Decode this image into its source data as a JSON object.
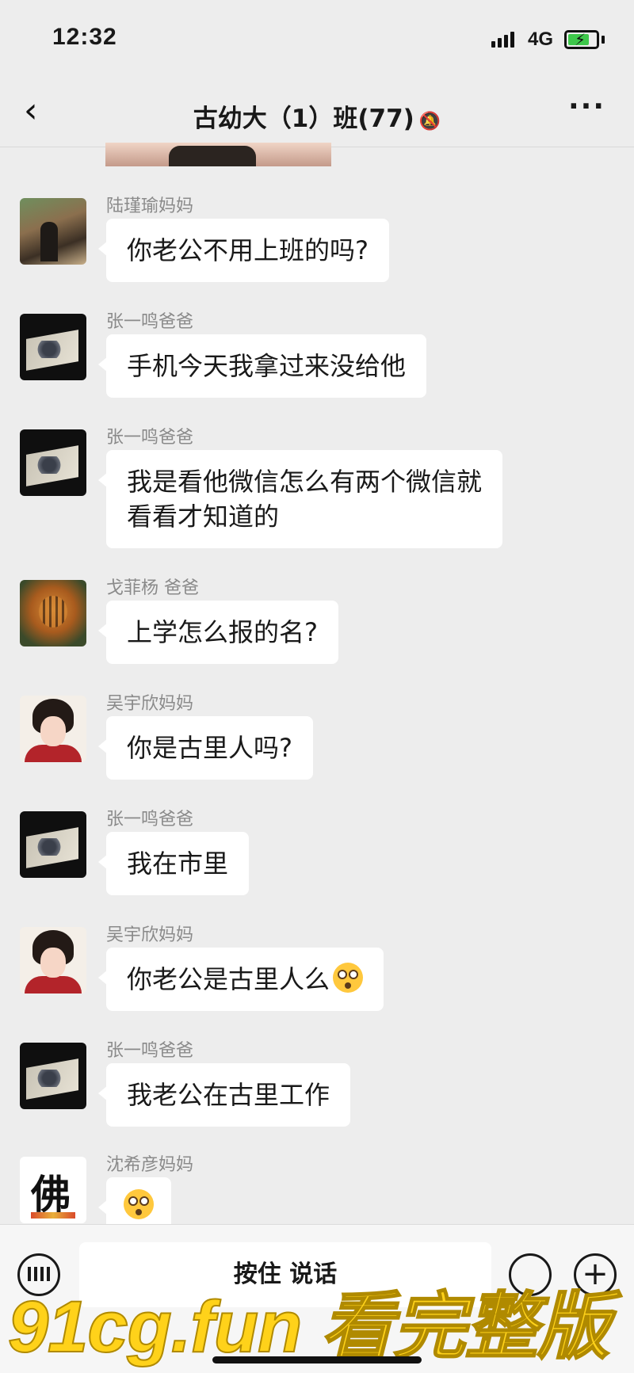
{
  "status": {
    "time": "12:32",
    "network": "4G"
  },
  "header": {
    "title": "古幼大（1）班(77)"
  },
  "messages": [
    {
      "sender": "陆瑾瑜妈妈",
      "text": "你老公不用上班的吗?",
      "avatar": "forest-photo"
    },
    {
      "sender": "张一鸣爸爸",
      "text": "手机今天我拿过来没给他",
      "avatar": "peacock-art"
    },
    {
      "sender": "张一鸣爸爸",
      "text": "我是看他微信怎么有两个微信就\n看看才知道的",
      "avatar": "peacock-art"
    },
    {
      "sender": "戈菲杨 爸爸",
      "text": "上学怎么报的名?",
      "avatar": "tiger-photo"
    },
    {
      "sender": "吴宇欣妈妈",
      "text": "你是古里人吗?",
      "avatar": "lady-illustration"
    },
    {
      "sender": "张一鸣爸爸",
      "text": "我在市里",
      "avatar": "peacock-art"
    },
    {
      "sender": "吴宇欣妈妈",
      "text": "你老公是古里人么",
      "avatar": "lady-illustration",
      "emoji": "flushed-face"
    },
    {
      "sender": "张一鸣爸爸",
      "text": "我老公在古里工作",
      "avatar": "peacock-art"
    },
    {
      "sender": "沈希彦妈妈",
      "text": "",
      "avatar": "calligraphy",
      "avatar_glyph": "佛",
      "emoji": "flushed-face"
    }
  ],
  "input": {
    "hold_to_talk": "按住 说话"
  },
  "watermark": "91cg.fun 看完整版",
  "icons": {
    "back": "chevron-left-icon",
    "mute": "bell-muted-icon",
    "more": "more-icon",
    "keyboard": "keyboard-icon",
    "emoji": "emoji-icon",
    "plus": "plus-icon"
  }
}
